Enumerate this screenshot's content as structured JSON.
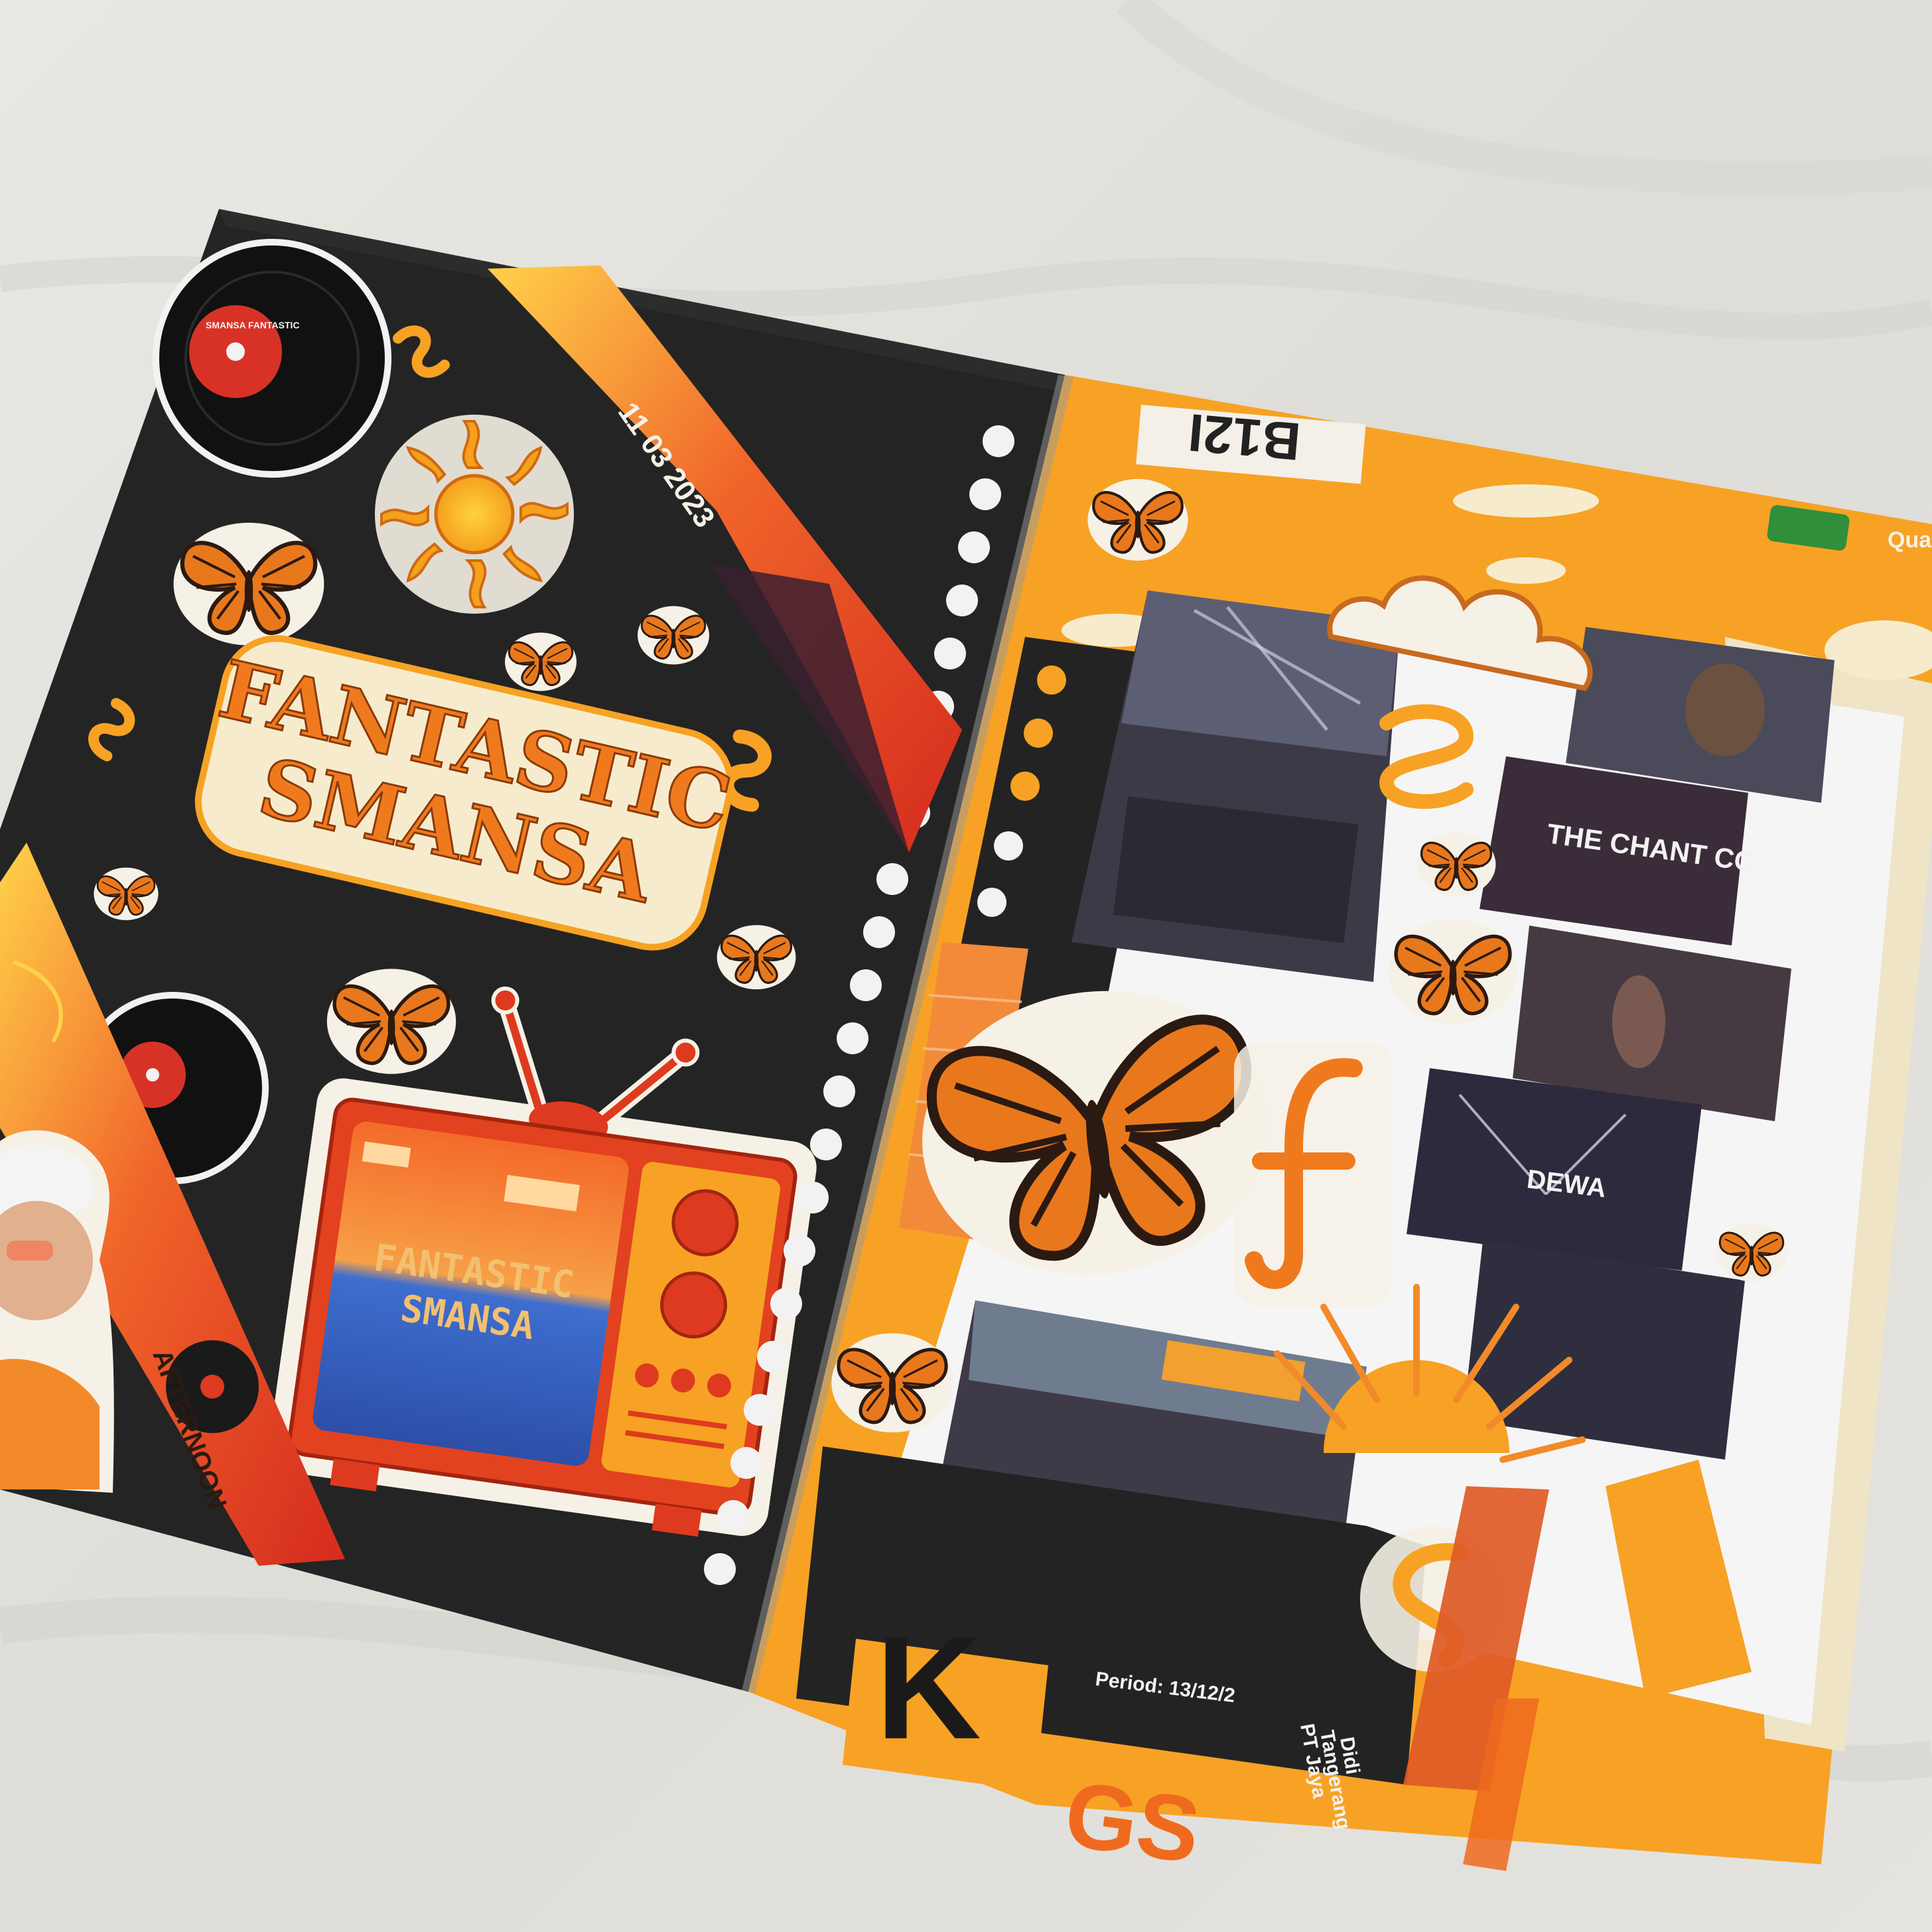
{
  "photo": {
    "subject": "scrapbook-spread",
    "colors": {
      "fabric": "#e7e6e2",
      "black_page": "#242424",
      "orange": "#f7a224",
      "deep_orange": "#ef6a1e",
      "red": "#de3a1f",
      "cream": "#f4e6c3",
      "white_dots": "#f2f2f2"
    }
  },
  "left_page": {
    "title_line1": "FANTASTIC",
    "title_line2": "SMANSA",
    "tv_line1": "FANTASTIC",
    "tv_line2": "SMANSA",
    "tape_top_text": "11 03 2023",
    "tape_bottom_text": "AFTERNOON",
    "record_label_text": "SMANSA FANTASTIC"
  },
  "right_page": {
    "top_label": "B12I",
    "corner_text": "Qua",
    "photo_text_1": "THE CHANT CG",
    "photo_text_2": "DEWA",
    "bottom_big_letter": "K",
    "receipt_lines": [
      "Period: 13/12/2",
      "PT Jaya",
      "Tangerang",
      "Didi"
    ],
    "bottom_orange_letters": "GS"
  }
}
